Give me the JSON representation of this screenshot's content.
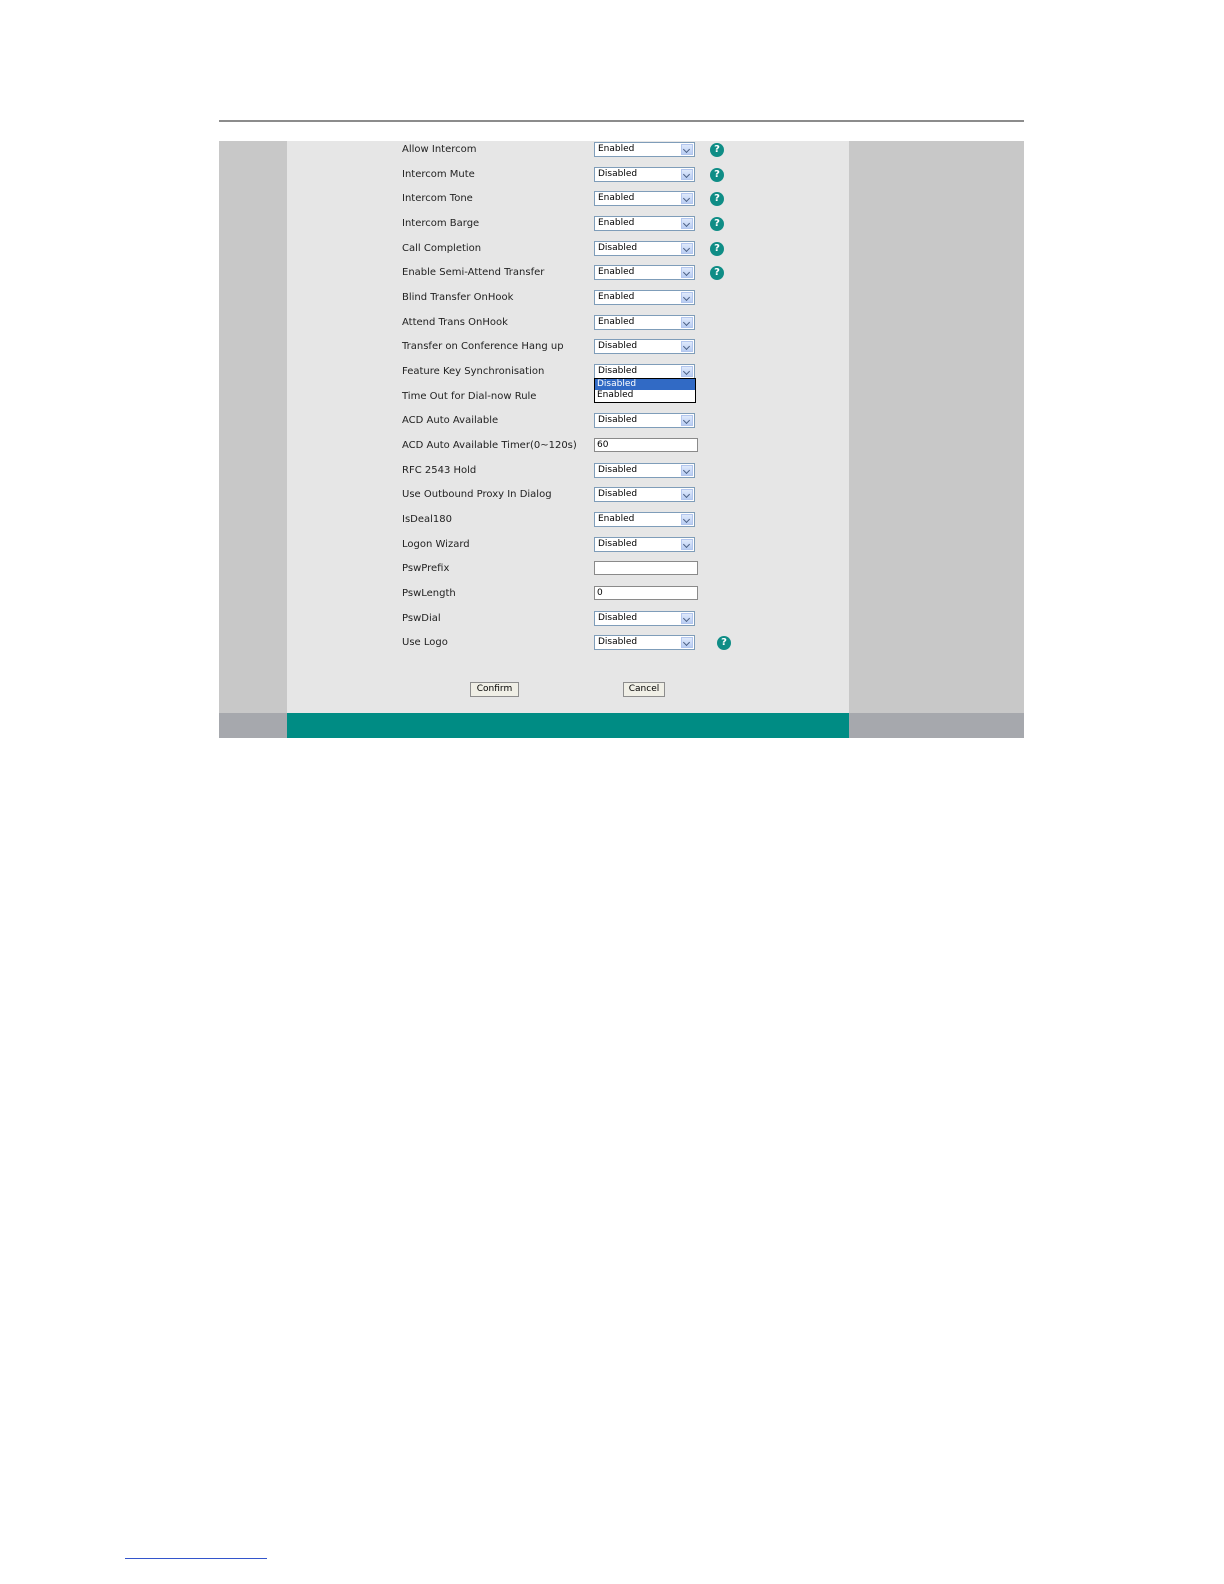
{
  "settings": [
    {
      "label": "Allow Intercom",
      "type": "select",
      "value": "Enabled",
      "help": true
    },
    {
      "label": "Intercom Mute",
      "type": "select",
      "value": "Disabled",
      "help": true
    },
    {
      "label": "Intercom Tone",
      "type": "select",
      "value": "Enabled",
      "help": true
    },
    {
      "label": "Intercom Barge",
      "type": "select",
      "value": "Enabled",
      "help": true
    },
    {
      "label": "Call Completion",
      "type": "select",
      "value": "Disabled",
      "help": true
    },
    {
      "label": "Enable Semi-Attend Transfer",
      "type": "select",
      "value": "Enabled",
      "help": true
    },
    {
      "label": "Blind Transfer OnHook",
      "type": "select",
      "value": "Enabled",
      "help": false
    },
    {
      "label": "Attend Trans OnHook",
      "type": "select",
      "value": "Enabled",
      "help": false
    },
    {
      "label": "Transfer on Conference Hang up",
      "type": "select",
      "value": "Disabled",
      "help": false
    },
    {
      "label": "Feature Key Synchronisation",
      "type": "select",
      "value": "Disabled",
      "help": false
    },
    {
      "label": "Time Out for Dial-now Rule",
      "type": "none",
      "value": "",
      "help": false
    },
    {
      "label": "ACD Auto Available",
      "type": "select",
      "value": "Disabled",
      "help": false
    },
    {
      "label": "ACD Auto Available Timer(0~120s)",
      "type": "text",
      "value": "60",
      "help": false
    },
    {
      "label": "RFC 2543 Hold",
      "type": "select",
      "value": "Disabled",
      "help": false
    },
    {
      "label": "Use Outbound Proxy In Dialog",
      "type": "select",
      "value": "Disabled",
      "help": false
    },
    {
      "label": "IsDeal180",
      "type": "select",
      "value": "Enabled",
      "help": false
    },
    {
      "label": "Logon Wizard",
      "type": "select",
      "value": "Disabled",
      "help": false
    },
    {
      "label": "PswPrefix",
      "type": "text",
      "value": "",
      "help": false
    },
    {
      "label": "PswLength",
      "type": "text",
      "value": "0",
      "help": false
    },
    {
      "label": "PswDial",
      "type": "select",
      "value": "Disabled",
      "help": false
    },
    {
      "label": "Use Logo",
      "type": "select",
      "value": "Disabled",
      "help": true
    }
  ],
  "open_dropdown": {
    "options": [
      "Disabled",
      "Enabled"
    ],
    "selected": "Disabled"
  },
  "buttons": {
    "confirm": "Confirm",
    "cancel": "Cancel"
  },
  "help_icon_glyph": "?",
  "colors": {
    "panel_bg": "#e6e6e6",
    "frame_bg": "#c8c8c8",
    "footer_accent": "#008c84",
    "help_icon": "#0f8d86",
    "dropdown_selected": "#316ac5"
  }
}
